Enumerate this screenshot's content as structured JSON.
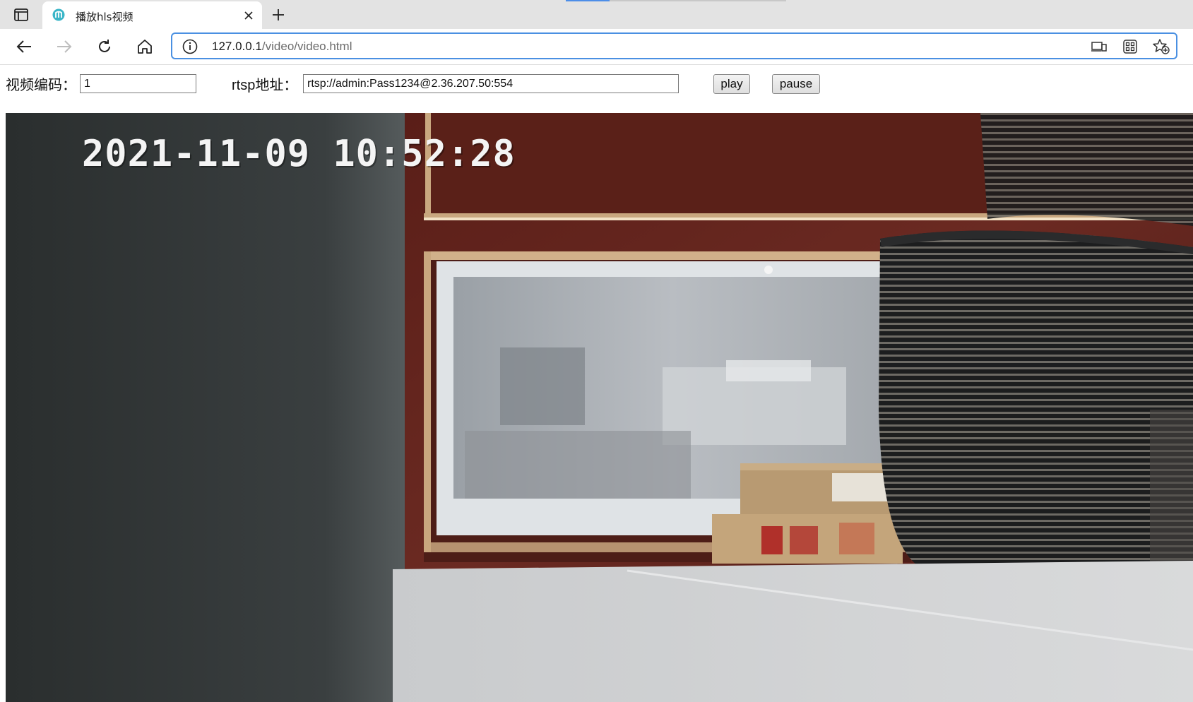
{
  "browser": {
    "tab": {
      "title": "播放hls视频",
      "close_icon": "close-icon",
      "favicon": "app-favicon"
    },
    "address_bar": {
      "host": "127.0.0.1",
      "path": "/video/video.html"
    }
  },
  "page": {
    "video_code": {
      "label": "视频编码：",
      "value": "1"
    },
    "rtsp": {
      "label": "rtsp地址：",
      "value": "rtsp://admin:Pass1234@2.36.207.50:554"
    },
    "play_label": "play",
    "pause_label": "pause"
  },
  "video": {
    "timestamp": "2021-11-09 10:52:28"
  },
  "colors": {
    "accent": "#4a90e2",
    "tab_strip": "#e3e3e3"
  }
}
